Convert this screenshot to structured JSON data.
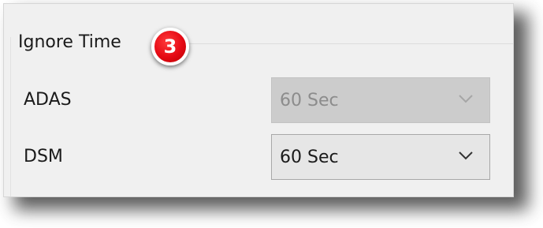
{
  "group": {
    "title": "Ignore Time",
    "badge": "3"
  },
  "rows": [
    {
      "label": "ADAS",
      "value": "60 Sec",
      "enabled": false
    },
    {
      "label": "DSM",
      "value": "60 Sec",
      "enabled": true
    }
  ],
  "icons": {
    "dropdown": "chevron-down-icon"
  },
  "colors": {
    "badge": "#e50914",
    "panel_bg": "#f0f0f0",
    "disabled_select_bg": "#cccccc",
    "enabled_select_bg": "#e6e6e6"
  }
}
